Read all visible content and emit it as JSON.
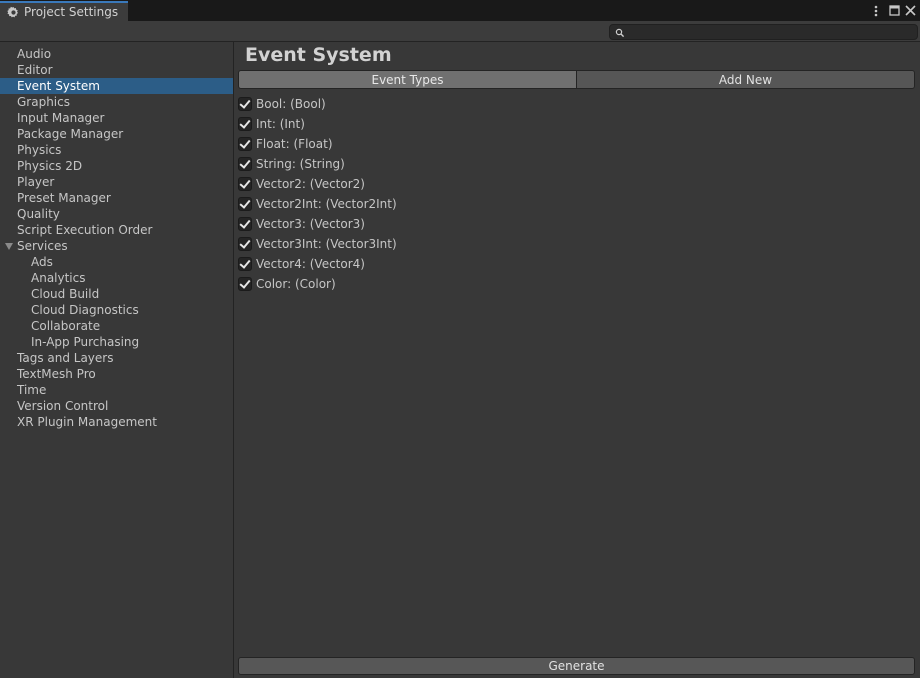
{
  "window": {
    "title": "Project Settings"
  },
  "search": {
    "value": "",
    "placeholder": ""
  },
  "sidebar": {
    "items": [
      {
        "label": "Audio",
        "level": 0
      },
      {
        "label": "Editor",
        "level": 0
      },
      {
        "label": "Event System",
        "level": 0,
        "selected": true
      },
      {
        "label": "Graphics",
        "level": 0
      },
      {
        "label": "Input Manager",
        "level": 0
      },
      {
        "label": "Package Manager",
        "level": 0
      },
      {
        "label": "Physics",
        "level": 0
      },
      {
        "label": "Physics 2D",
        "level": 0
      },
      {
        "label": "Player",
        "level": 0
      },
      {
        "label": "Preset Manager",
        "level": 0
      },
      {
        "label": "Quality",
        "level": 0
      },
      {
        "label": "Script Execution Order",
        "level": 0
      },
      {
        "label": "Services",
        "level": 0,
        "expanded": true
      },
      {
        "label": "Ads",
        "level": 1
      },
      {
        "label": "Analytics",
        "level": 1
      },
      {
        "label": "Cloud Build",
        "level": 1
      },
      {
        "label": "Cloud Diagnostics",
        "level": 1
      },
      {
        "label": "Collaborate",
        "level": 1
      },
      {
        "label": "In-App Purchasing",
        "level": 1
      },
      {
        "label": "Tags and Layers",
        "level": 0
      },
      {
        "label": "TextMesh Pro",
        "level": 0
      },
      {
        "label": "Time",
        "level": 0
      },
      {
        "label": "Version Control",
        "level": 0
      },
      {
        "label": "XR Plugin Management",
        "level": 0
      }
    ]
  },
  "main": {
    "title": "Event System",
    "tabs": [
      {
        "label": "Event Types",
        "active": true
      },
      {
        "label": "Add New",
        "active": false
      }
    ],
    "event_types": [
      {
        "label": "Bool: (Bool)",
        "checked": true
      },
      {
        "label": "Int: (Int)",
        "checked": true
      },
      {
        "label": "Float: (Float)",
        "checked": true
      },
      {
        "label": "String: (String)",
        "checked": true
      },
      {
        "label": "Vector2: (Vector2)",
        "checked": true
      },
      {
        "label": "Vector2Int: (Vector2Int)",
        "checked": true
      },
      {
        "label": "Vector3: (Vector3)",
        "checked": true
      },
      {
        "label": "Vector3Int: (Vector3Int)",
        "checked": true
      },
      {
        "label": "Vector4: (Vector4)",
        "checked": true
      },
      {
        "label": "Color: (Color)",
        "checked": true
      }
    ],
    "generate_label": "Generate"
  },
  "colors": {
    "background": "#383838",
    "selection": "#2c5d87",
    "tab_accent": "#3a79bb",
    "button": "#575757",
    "active_tab": "#707070"
  },
  "icons": {
    "tab": "gear-icon",
    "more": "kebab-menu-icon",
    "maximize": "maximize-icon",
    "close": "close-icon",
    "search": "search-icon",
    "foldout": "triangle-down-icon",
    "check": "checkmark-icon"
  }
}
